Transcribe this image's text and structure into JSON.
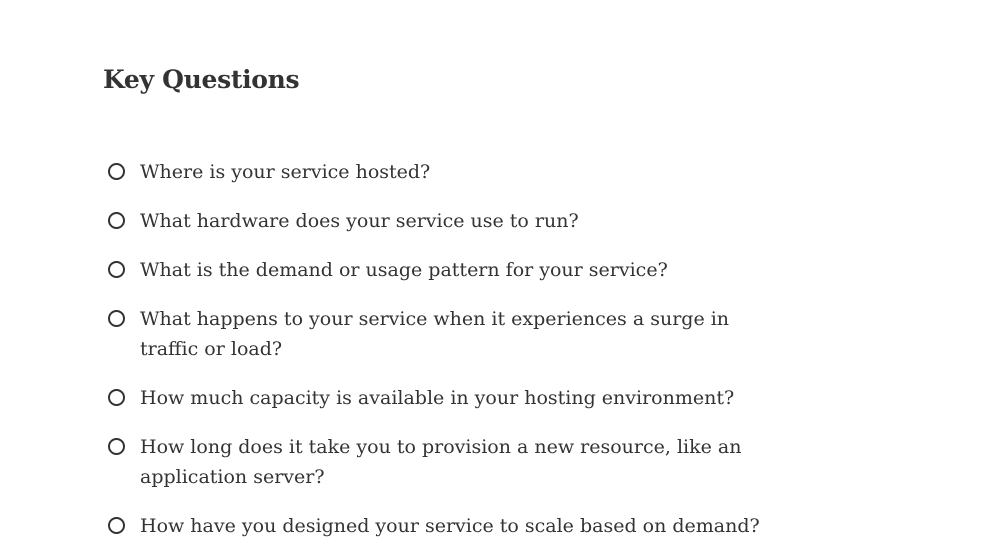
{
  "page": {
    "title": "Key Questions"
  },
  "checklist": {
    "items": [
      {
        "label": "Where is your service hosted?",
        "checked": false
      },
      {
        "label": "What hardware does your service use to run?",
        "checked": false
      },
      {
        "label": "What is the demand or usage pattern for your service?",
        "checked": false
      },
      {
        "label": "What happens to your service when it experiences a surge in traffic or load?",
        "checked": false
      },
      {
        "label": "How much capacity is available in your hosting environment?",
        "checked": false
      },
      {
        "label": "How long does it take you to provision a new resource, like an application server?",
        "checked": false
      },
      {
        "label": "How have you designed your service to scale based on demand?",
        "checked": false
      }
    ]
  }
}
